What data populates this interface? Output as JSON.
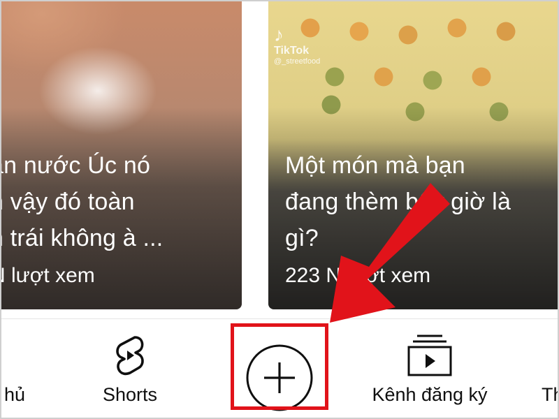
{
  "feed": {
    "cards": [
      {
        "title_lines": [
          "ăn nước Úc nó",
          "n vậy đó toàn",
          "n trái không à ..."
        ],
        "views": "N lượt xem"
      },
      {
        "watermark": {
          "logo": "♪",
          "brand": "TikTok",
          "handle": "@_streetfood"
        },
        "title_lines": [
          "Một món mà bạn",
          "đang thèm bây giờ là",
          "gì?"
        ],
        "views": "223 N lượt xem"
      }
    ]
  },
  "bottom_nav": {
    "home_label": "hủ",
    "shorts_label": "Shorts",
    "create_icon": "plus-circle-icon",
    "subscriptions_label": "Kênh đăng ký",
    "library_label": "Th"
  },
  "annotation": {
    "highlight_color": "#e1131a",
    "arrow_color": "#e1131a"
  }
}
